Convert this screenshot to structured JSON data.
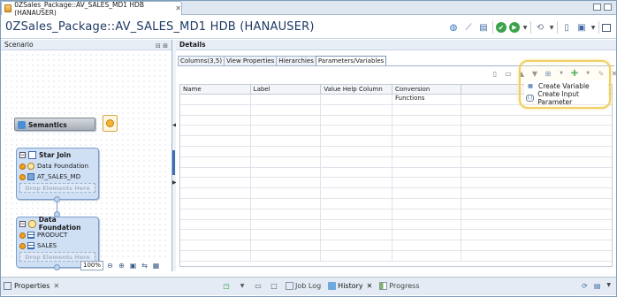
{
  "editor": {
    "tab_label": "0ZSales_Package::AV_SALES_MD1 HDB (HANAUSER)",
    "title": "0ZSales_Package::AV_SALES_MD1 HDB (HANAUSER)"
  },
  "toolbar": {
    "icons": [
      "globe-icon",
      "chart-icon",
      "table-icon",
      "validate-icon",
      "activate-icon",
      "history-icon",
      "document-icon",
      "save-icon",
      "maximize-icon"
    ]
  },
  "scenario": {
    "header": "Scenario",
    "semantics_label": "Semantics",
    "star_join": {
      "label": "Star Join",
      "items": [
        "Data Foundation",
        "AT_SALES_MD"
      ],
      "drop": "Drop Elements Here"
    },
    "data_foundation": {
      "label": "Data Foundation",
      "items": [
        "PRODUCT",
        "SALES"
      ],
      "drop": "Drop Elements Here"
    },
    "zoom": "100%"
  },
  "details": {
    "header": "Details",
    "tabs": [
      "Columns(3,5)",
      "View Properties",
      "Hierarchies",
      "Parameters/Variables"
    ],
    "active_tab": "Parameters/Variables",
    "columns": [
      "Name",
      "Label",
      "Value Help Column",
      "Conversion Functions"
    ],
    "menu": {
      "items": [
        "Create Variable",
        "Create Input Parameter"
      ]
    }
  },
  "bottom": {
    "properties": "Properties",
    "views": [
      "Job Log",
      "History",
      "Progress"
    ],
    "active_view": "History"
  },
  "colors": {
    "accent": "#3c6fb3",
    "highlight": "#f0cf63",
    "node_fill": "#cfe0f5"
  }
}
